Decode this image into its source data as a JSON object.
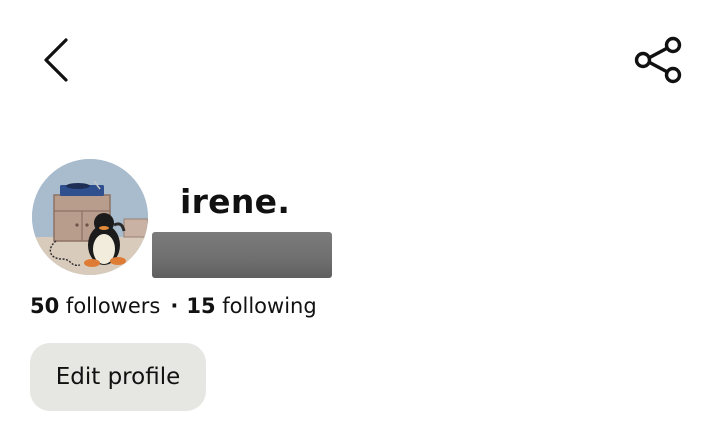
{
  "header": {
    "back_icon": "chevron-left-icon",
    "share_icon": "share-icon"
  },
  "profile": {
    "display_name": "irene.",
    "avatar_icon": "avatar-image",
    "followers_count": "50",
    "followers_label": "followers",
    "separator": "·",
    "following_count": "15",
    "following_label": "following",
    "edit_button_label": "Edit profile"
  },
  "colors": {
    "background": "#ffffff",
    "text": "#111111",
    "button_background": "#e6e6e2",
    "redaction": "#757575"
  }
}
